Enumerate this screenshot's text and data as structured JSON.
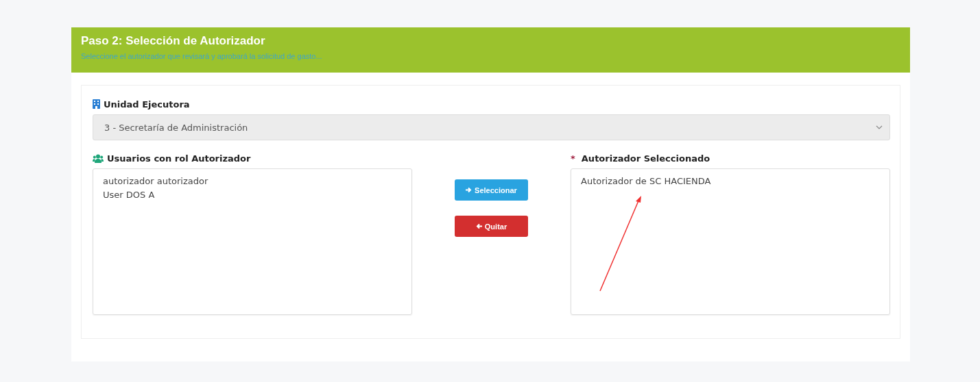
{
  "header": {
    "title": "Paso 2: Selección de Autorizador",
    "subtitle": "Seleccione el autorizador que revisará y aprobará la solicitud de gasto..."
  },
  "unit": {
    "label": "Unidad Ejecutora",
    "value": "3 - Secretaría de Administración"
  },
  "available": {
    "label": "Usuarios con rol Autorizador",
    "items": [
      {
        "label": "autorizador autorizador",
        "selected": false
      },
      {
        "label": "User DOS A",
        "selected": false
      }
    ]
  },
  "buttons": [
    {
      "kind": "add",
      "label": "Seleccionar"
    },
    {
      "kind": "remove",
      "label": "Quitar"
    }
  ],
  "chosen": {
    "label": "Autorizador Seleccionado",
    "required_mark": "*",
    "items": [
      {
        "label": "Autorizador de SC HACIENDA",
        "selected": false
      }
    ]
  }
}
